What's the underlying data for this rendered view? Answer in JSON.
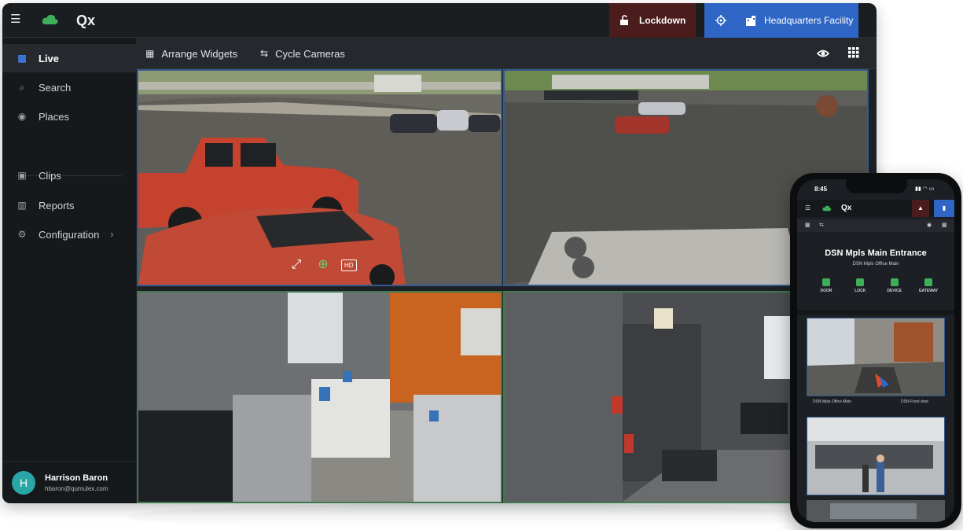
{
  "topbar": {
    "app_logo": "Qx",
    "lockdown_label": "Lockdown",
    "facility_label": "Headquarters Facility",
    "icons": [
      "menu-icon",
      "cloud-icon",
      "unlock-icon",
      "target-icon",
      "building-icon"
    ]
  },
  "sidebar": {
    "items": [
      {
        "label": "Live",
        "icon": "grid-icon",
        "active": true
      },
      {
        "label": "Search",
        "icon": "search-icon"
      },
      {
        "label": "Places",
        "icon": "pin-icon"
      },
      {
        "label": "Clips",
        "icon": "clip-icon"
      },
      {
        "label": "Reports",
        "icon": "bar-chart-icon"
      },
      {
        "label": "Configuration",
        "icon": "gear-icon",
        "has_chevron": true
      }
    ],
    "user": {
      "initial": "H",
      "name": "Harrison Baron",
      "email": "hbaron@qumulex.com"
    }
  },
  "toolbar": {
    "arrange_label": "Arrange Widgets",
    "cycle_label": "Cycle Cameras"
  },
  "camera_overlay": {
    "hd_label": "HD"
  },
  "colors": {
    "accent_blue": "#2f66c5",
    "lockdown_red": "#4a1c1c",
    "brand_green": "#3fae5a",
    "sidebar_bg": "#16191c"
  },
  "phone": {
    "time": "8:45",
    "app_logo": "Qx",
    "title": "DSN Mpls Main Entrance",
    "subtitle": "DSN Mpls Office Main",
    "actions": [
      "DOOR",
      "LOCK",
      "DEVICE",
      "GATEWAY"
    ],
    "cam1_caption_left": "DSN Mpls Office Main",
    "cam1_caption_right": "DSN Front door"
  }
}
